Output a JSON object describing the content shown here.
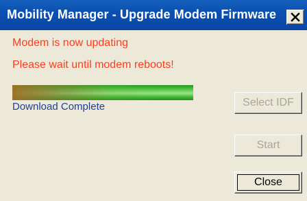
{
  "window": {
    "title": "Mobility Manager - Upgrade Modem Firmware"
  },
  "messages": {
    "line1": "Modem is now updating",
    "line2": "Please wait until modem reboots!"
  },
  "progress": {
    "fraction": 1.0,
    "status_text": "Download Complete"
  },
  "buttons": {
    "select_idf": "Select IDF",
    "start": "Start",
    "close": "Close"
  },
  "icons": {
    "close": "close-x-icon"
  },
  "colors": {
    "title_bar": "#0a50b0",
    "message_text": "#ff3b1f",
    "status_text": "#1f3f96",
    "progress_fill": "#4cbf3c",
    "disabled_text": "#a8a69c"
  }
}
